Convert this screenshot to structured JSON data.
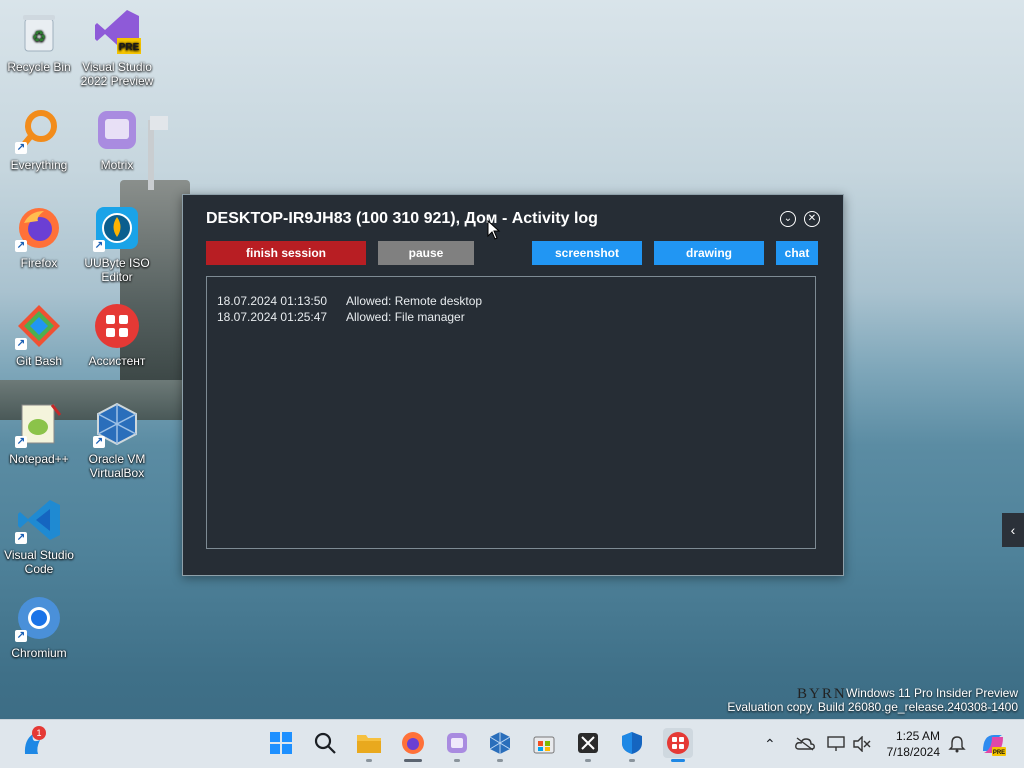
{
  "desktop": {
    "icons": [
      {
        "label": "Recycle Bin",
        "icon": "recycle-bin-icon"
      },
      {
        "label": "Visual Studio 2022 Preview",
        "icon": "visual-studio-preview-icon",
        "badge": "PRE"
      },
      {
        "label": "Everything",
        "icon": "everything-search-icon"
      },
      {
        "label": "Motrix",
        "icon": "motrix-icon"
      },
      {
        "label": "Firefox",
        "icon": "firefox-icon"
      },
      {
        "label": "UUByte ISO Editor",
        "icon": "uubyte-iso-editor-icon"
      },
      {
        "label": "Git Bash",
        "icon": "git-bash-icon"
      },
      {
        "label": "Ассистент",
        "icon": "assistant-icon"
      },
      {
        "label": "Notepad++",
        "icon": "notepad-plus-plus-icon"
      },
      {
        "label": "Oracle VM VirtualBox",
        "icon": "virtualbox-icon"
      },
      {
        "label": "Visual Studio Code",
        "icon": "vscode-icon"
      },
      {
        "label": "Chromium",
        "icon": "chromium-icon"
      }
    ]
  },
  "window": {
    "title": "DESKTOP-IR9JH83 (100 310 921), Дом - Activity log",
    "buttons": {
      "finish": "finish session",
      "pause": "pause",
      "screenshot": "screenshot",
      "drawing": "drawing",
      "chat": "chat"
    },
    "log": [
      {
        "ts": "18.07.2024 01:13:50",
        "msg": "Allowed: Remote desktop"
      },
      {
        "ts": "18.07.2024 01:25:47",
        "msg": "Allowed: File manager"
      }
    ],
    "colors": {
      "finish": "#b81e23",
      "pause": "#808080",
      "action": "#2196f3"
    }
  },
  "watermark": {
    "line1": "Windows 11 Pro Insider Preview",
    "line2": "Evaluation copy. Build 26080.ge_release.240308-1400",
    "brand": "BYRN"
  },
  "taskbar": {
    "widgets_badge": "1",
    "clock_time": "1:25 AM",
    "clock_date": "7/18/2024"
  }
}
